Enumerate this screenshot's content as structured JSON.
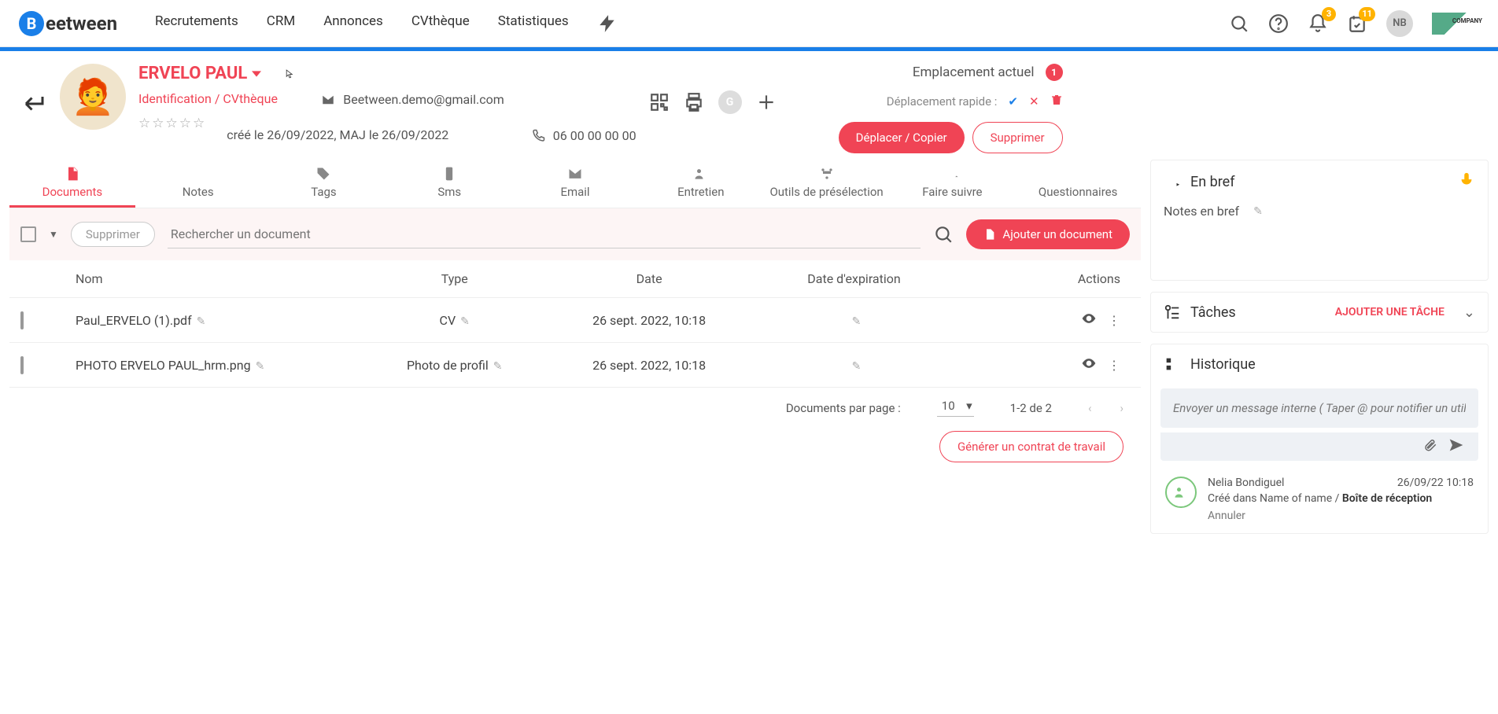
{
  "brand": "eetween",
  "nav": [
    "Recrutements",
    "CRM",
    "Annonces",
    "CVthèque",
    "Statistiques"
  ],
  "badges": {
    "bell": "3",
    "task": "11"
  },
  "user_initials": "NB",
  "candidate": {
    "name": "ERVELO PAUL",
    "source": "Identification / CVthèque",
    "created": "créé le 26/09/2022, MAJ le 26/09/2022",
    "email": "Beetween.demo@gmail.com",
    "phone": "06 00 00 00 00"
  },
  "placement": {
    "label": "Emplacement actuel",
    "count": "1",
    "quick": "Déplacement rapide :",
    "move": "Déplacer / Copier",
    "delete": "Supprimer"
  },
  "tabs": [
    "Documents",
    "Notes",
    "Tags",
    "Sms",
    "Email",
    "Entretien",
    "Outils de présélection",
    "Faire suivre",
    "Questionnaires"
  ],
  "docbar": {
    "delete": "Supprimer",
    "search_ph": "Rechercher un document",
    "add": "Ajouter un document"
  },
  "thead": {
    "name": "Nom",
    "type": "Type",
    "date": "Date",
    "exp": "Date d'expiration",
    "actions": "Actions"
  },
  "rows": [
    {
      "name": "Paul_ERVELO (1).pdf",
      "type": "CV",
      "date": "26 sept. 2022, 10:18"
    },
    {
      "name": "PHOTO ERVELO PAUL_hrm.png",
      "type": "Photo de profil",
      "date": "26 sept. 2022, 10:18"
    }
  ],
  "pager": {
    "label": "Documents par page :",
    "size": "10",
    "range": "1-2 de 2"
  },
  "generate": "Générer un contrat de travail",
  "brief": {
    "title": "En bref",
    "notes": "Notes en bref"
  },
  "tasks": {
    "title": "Tâches",
    "add": "AJOUTER UNE TÂCHE"
  },
  "history": {
    "title": "Historique",
    "msg_ph": "Envoyer un message interne ( Taper @ pour notifier un utilisateur ) ...",
    "item": {
      "author": "Nelia Bondiguel",
      "time": "26/09/22 10:18",
      "text1": "Créé dans Name of name / ",
      "text2": "Boîte de réception",
      "cancel": "Annuler"
    }
  }
}
